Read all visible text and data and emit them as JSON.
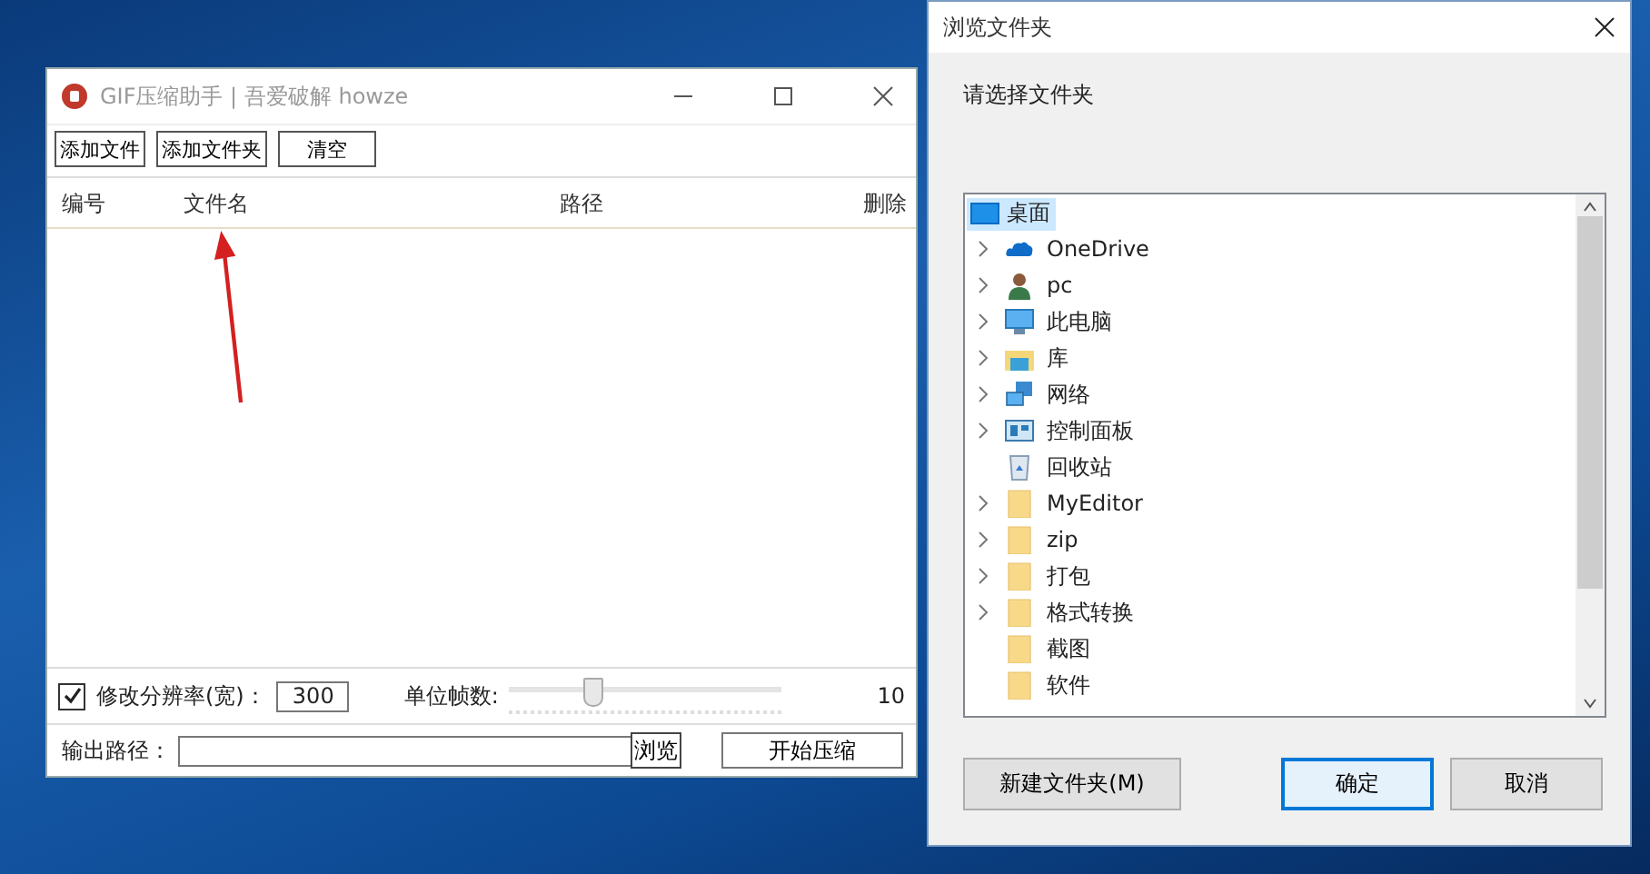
{
  "main_window": {
    "title": "GIF压缩助手 | 吾爱破解 howze",
    "toolbar": [
      "添加文件",
      "添加文件夹",
      "清空"
    ],
    "table": {
      "columns": [
        "编号",
        "文件名",
        "路径",
        "删除"
      ]
    },
    "resize": {
      "checked": true,
      "label": "修改分辨率(宽)：",
      "value": "300"
    },
    "frames": {
      "label": "单位帧数:",
      "level": 0.31,
      "reading": "10"
    },
    "output": {
      "label": "输出路径：",
      "browse": "浏览",
      "start": "开始压缩"
    }
  },
  "dialog": {
    "title": "浏览文件夹",
    "prompt": "请选择文件夹",
    "tree": {
      "label": "桌面",
      "kind": "desktop",
      "selected": true,
      "children": [
        {
          "label": "OneDrive",
          "kind": "cloud",
          "expandable": true,
          "selected": false
        },
        {
          "label": "pc",
          "kind": "user",
          "expandable": true,
          "selected": false
        },
        {
          "label": "此电脑",
          "kind": "computer",
          "expandable": true,
          "selected": false
        },
        {
          "label": "库",
          "kind": "library",
          "expandable": true,
          "selected": false
        },
        {
          "label": "网络",
          "kind": "network",
          "expandable": true,
          "selected": false
        },
        {
          "label": "控制面板",
          "kind": "control",
          "expandable": true,
          "selected": false
        },
        {
          "label": "回收站",
          "kind": "recycle",
          "expandable": false,
          "selected": false
        },
        {
          "label": "MyEditor",
          "kind": "folder",
          "expandable": true,
          "selected": false
        },
        {
          "label": "zip",
          "kind": "folder",
          "expandable": true,
          "selected": false
        },
        {
          "label": "打包",
          "kind": "folder",
          "expandable": true,
          "selected": false
        },
        {
          "label": "格式转换",
          "kind": "folder",
          "expandable": true,
          "selected": false
        },
        {
          "label": "截图",
          "kind": "folder",
          "expandable": false,
          "selected": false
        },
        {
          "label": "软件",
          "kind": "folder",
          "expandable": false,
          "selected": false
        }
      ]
    },
    "buttons": [
      {
        "label": "新建文件夹(M)",
        "default": false
      },
      {
        "label": "确定",
        "default": true
      },
      {
        "label": "取消",
        "default": false
      }
    ]
  }
}
